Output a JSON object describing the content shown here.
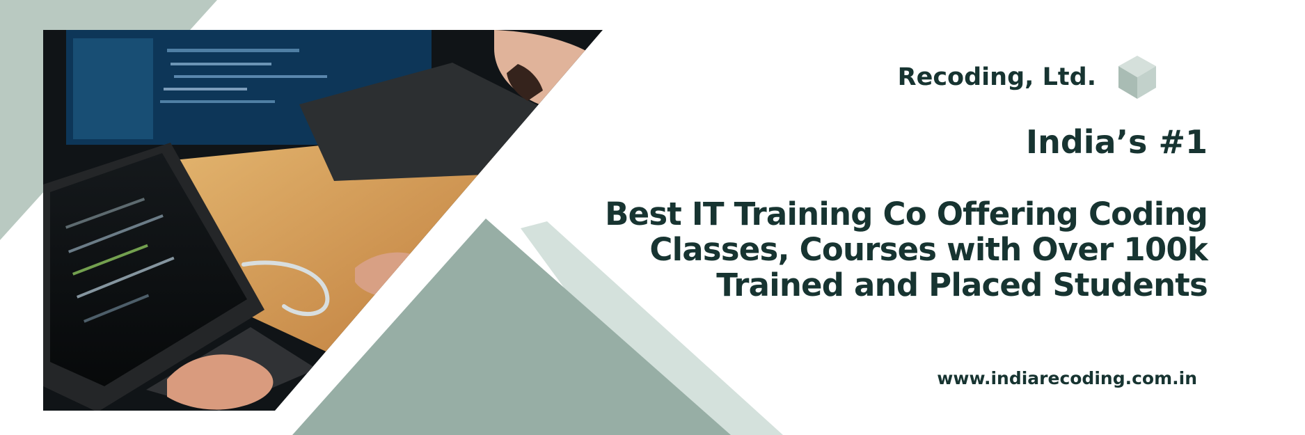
{
  "brand": {
    "name": "Recoding, Ltd.",
    "logo_icon": "cube-icon"
  },
  "rank": {
    "text": "India’s  #1"
  },
  "headline": {
    "lines": [
      "Best IT Training Co Offering Coding",
      "Classes, Courses with Over 100k",
      "Trained and Placed Students"
    ]
  },
  "website": {
    "url": "www.indiarecoding.com.in"
  },
  "colors": {
    "text": "#173431",
    "sage": "#97aea5",
    "light_sage": "#d4e1dc",
    "pale_sage": "#b9c9c1",
    "background": "#ffffff"
  }
}
